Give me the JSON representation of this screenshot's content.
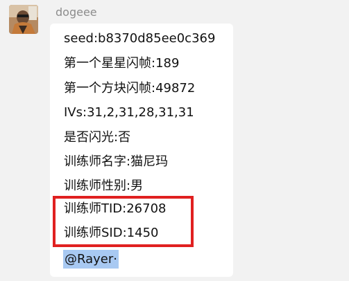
{
  "sender": {
    "name": "dogeee"
  },
  "message": {
    "lines": [
      "seed:b8370d85ee0c369",
      "第一个星星闪帧:189",
      "第一个方块闪帧:49872",
      "IVs:31,2,31,28,31,31",
      "是否闪光:否",
      "训练师名字:猫尼玛",
      "训练师性别:男",
      "训练师TID:26708",
      "训练师SID:1450"
    ],
    "mention": "@Rayer·"
  },
  "colors": {
    "highlight_border": "#e02020",
    "mention_background": "#a8c9f2",
    "chat_background": "#f2f2f2",
    "bubble_background": "#ffffff"
  },
  "icons": {
    "avatar": "user-avatar-photo"
  }
}
